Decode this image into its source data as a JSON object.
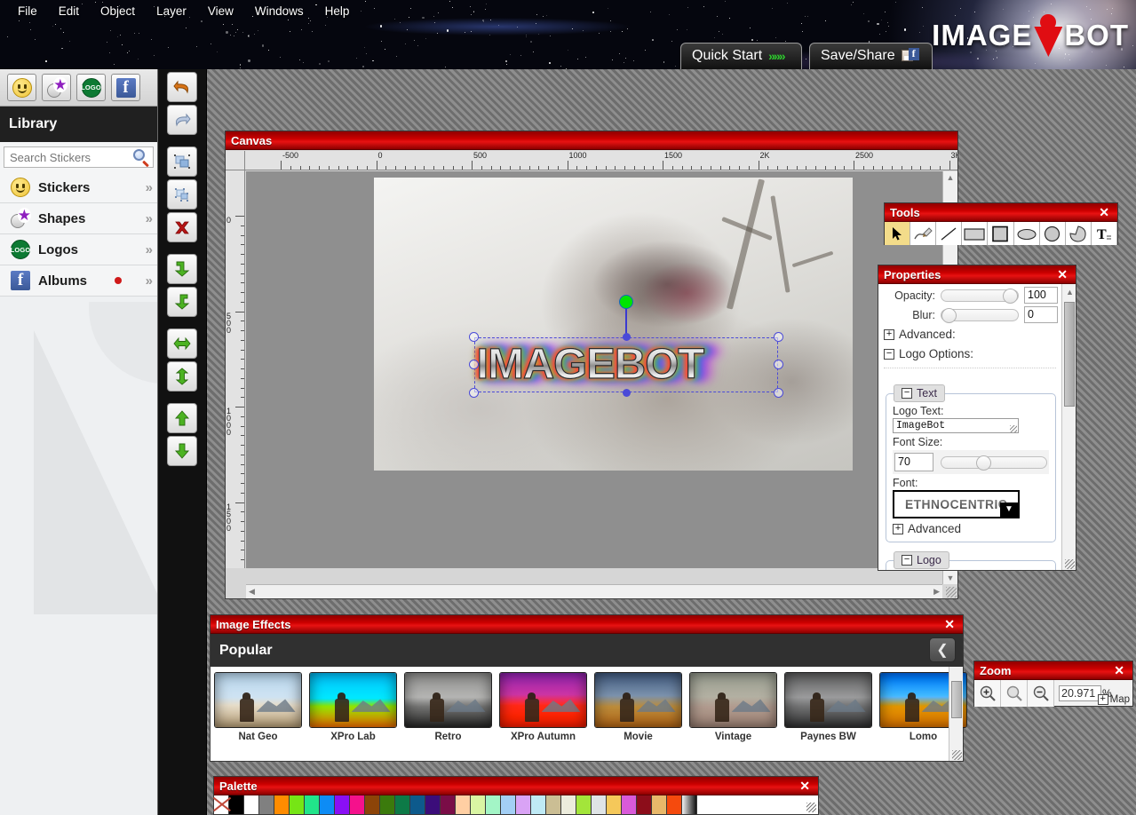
{
  "app": {
    "brand_left": "IMAGE",
    "brand_right": "BOT",
    "brand_color": "#e00d12"
  },
  "menubar": {
    "items": [
      "File",
      "Edit",
      "Object",
      "Layer",
      "View",
      "Windows",
      "Help"
    ]
  },
  "header_buttons": {
    "quick_start": {
      "label": "Quick Start",
      "icon": "chevrons-right-icon"
    },
    "save_share": {
      "label": "Save/Share",
      "icon": "save-facebook-icon"
    }
  },
  "library": {
    "title": "Library",
    "tabs": [
      {
        "name": "stickers-tab",
        "icon": "smiley-icon"
      },
      {
        "name": "shapes-tab",
        "icon": "shapes-star-icon"
      },
      {
        "name": "logos-tab",
        "icon": "logo-badge-icon",
        "text": "LOGO"
      },
      {
        "name": "albums-tab",
        "icon": "facebook-icon",
        "text": "f"
      }
    ],
    "search": {
      "placeholder": "Search Stickers",
      "value": "",
      "icon": "magnifier-icon"
    },
    "items": [
      {
        "label": "Stickers",
        "icon": "smiley-icon",
        "badge": false,
        "arrow": "»"
      },
      {
        "label": "Shapes",
        "icon": "shapes-star-icon",
        "badge": false,
        "arrow": "»"
      },
      {
        "label": "Logos",
        "icon": "logo-badge-icon",
        "badge": false,
        "arrow": "»"
      },
      {
        "label": "Albums",
        "icon": "facebook-icon",
        "badge": true,
        "arrow": "»"
      }
    ]
  },
  "toolrail": {
    "buttons": [
      {
        "name": "undo-button",
        "icon": "undo-arrow-icon"
      },
      {
        "name": "redo-button",
        "icon": "redo-arrow-icon"
      },
      {
        "name": "group-button",
        "icon": "group-objects-icon"
      },
      {
        "name": "ungroup-button",
        "icon": "ungroup-objects-icon"
      },
      {
        "name": "delete-button",
        "icon": "red-x-icon"
      },
      {
        "name": "send-backward-button",
        "icon": "arrow-down-left-icon"
      },
      {
        "name": "bring-forward-button",
        "icon": "arrow-down-right-icon"
      },
      {
        "name": "flip-horizontal-button",
        "icon": "arrow-left-right-icon"
      },
      {
        "name": "flip-vertical-button",
        "icon": "arrow-up-down-icon"
      },
      {
        "name": "move-up-button",
        "icon": "arrow-up-icon"
      },
      {
        "name": "move-down-button",
        "icon": "arrow-down-icon"
      }
    ]
  },
  "canvas": {
    "title": "Canvas",
    "h_ruler_labels": [
      "-500",
      "0",
      "500",
      "1000",
      "1500",
      "2K",
      "2500",
      "3K"
    ],
    "v_ruler_labels": [
      "0",
      "500",
      "1000",
      "1500"
    ],
    "selection": {
      "object_type": "logo-text",
      "text": "IMAGEBOT"
    }
  },
  "tools": {
    "title": "Tools",
    "close": "✕",
    "items": [
      {
        "name": "select-tool",
        "icon": "cursor-arrow-icon",
        "selected": true
      },
      {
        "name": "pencil-tool",
        "icon": "pencil-icon",
        "selected": false
      },
      {
        "name": "line-tool",
        "icon": "line-icon",
        "selected": false
      },
      {
        "name": "rectangle-tool",
        "icon": "rectangle-icon",
        "selected": false
      },
      {
        "name": "square-tool",
        "icon": "filled-square-icon",
        "selected": false
      },
      {
        "name": "ellipse-tool",
        "icon": "ellipse-icon",
        "selected": false
      },
      {
        "name": "circle-tool",
        "icon": "circle-icon",
        "selected": false
      },
      {
        "name": "freeform-tool",
        "icon": "blob-shape-icon",
        "selected": false
      },
      {
        "name": "text-tool",
        "icon": "text-t-icon",
        "selected": false
      }
    ]
  },
  "properties": {
    "title": "Properties",
    "close": "✕",
    "opacity": {
      "label": "Opacity:",
      "value": "100",
      "slider_pct": 100
    },
    "blur": {
      "label": "Blur:",
      "value": "0",
      "slider_pct": 0
    },
    "advanced_section": {
      "label": "Advanced:",
      "toggle": "+"
    },
    "logo_options_section": {
      "label": "Logo Options:",
      "toggle": "−"
    },
    "text_group": {
      "legend": "Text",
      "legend_toggle": "−",
      "logo_text_label": "Logo Text:",
      "logo_text_value": "ImageBot",
      "font_size_label": "Font Size:",
      "font_size_value": "70",
      "font_size_slider_pct": 33,
      "font_label": "Font:",
      "font_value": "ETHNOCENTRIC",
      "advanced_label": "Advanced",
      "advanced_toggle": "+"
    },
    "logo_group": {
      "legend": "Logo",
      "legend_toggle": "−"
    }
  },
  "effects": {
    "title": "Image Effects",
    "close": "✕",
    "category": "Popular",
    "back_icon": "back-arrow-icon",
    "items": [
      {
        "label": "Nat Geo",
        "style": "natgeo"
      },
      {
        "label": "XPro Lab",
        "style": "xprolab"
      },
      {
        "label": "Retro",
        "style": "retro"
      },
      {
        "label": "XPro Autumn",
        "style": "xproautumn"
      },
      {
        "label": "Movie",
        "style": "movie"
      },
      {
        "label": "Vintage",
        "style": "vintage"
      },
      {
        "label": "Paynes BW",
        "style": "paynesbw"
      },
      {
        "label": "Lomo",
        "style": "lomo"
      }
    ]
  },
  "zoom": {
    "title": "Zoom",
    "close": "✕",
    "zoom_in_icon": "magnifier-plus-icon",
    "zoom_fit_icon": "magnifier-icon",
    "zoom_out_icon": "magnifier-minus-icon",
    "value": "20.971",
    "unit": "%",
    "map_label": "Map",
    "map_toggle": "+"
  },
  "palette": {
    "title": "Palette",
    "close": "✕",
    "colors": [
      "none",
      "#000000",
      "#ffffff",
      "#808080",
      "#ff8c00",
      "#76e515",
      "#21e58a",
      "#0d8cf5",
      "#8a0ff5",
      "#f5118c",
      "#8c4408",
      "#3b7a0c",
      "#0d7a47",
      "#0d5a8c",
      "#3b0d7a",
      "#7a0d47",
      "#ffcfa3",
      "#d9f5a3",
      "#a3f5c6",
      "#a3cff5",
      "#d9a3f5",
      "#bfeaf5",
      "#cbbe94",
      "#ececdc",
      "#a3e53a",
      "#dfe4e6",
      "#f5c85a",
      "#d95ad9",
      "#8c0d1a",
      "#e8b86a",
      "#f54a0d",
      "gradient"
    ]
  }
}
